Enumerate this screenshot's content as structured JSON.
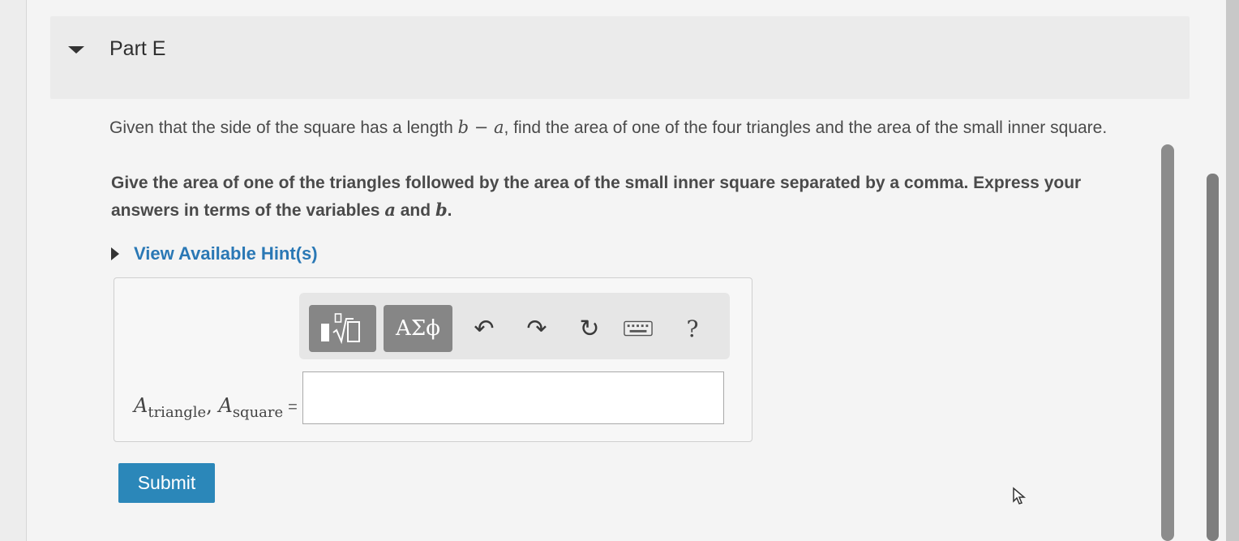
{
  "part": {
    "title": "Part E"
  },
  "question": {
    "text_pre": "Given that the side of the square has a length ",
    "expr": "b − a",
    "text_post": ", find the area of one of the four triangles and the area of the small inner square."
  },
  "instruction": {
    "text_pre": "Give the area of one of the triangles followed by the area of the small inner square separated by a comma. Express your answers in terms of the variables ",
    "var_a": "a",
    "text_mid": " and ",
    "var_b": "b",
    "text_post": "."
  },
  "hint": {
    "label": "View Available Hint(s)"
  },
  "toolbar": {
    "greek_label": "ΑΣϕ",
    "undo_glyph": "↶",
    "redo_glyph": "↷",
    "reset_glyph": "↻",
    "help_label": "?",
    "icons": [
      "templates-icon",
      "undo-icon",
      "redo-icon",
      "reset-icon",
      "keyboard-icon"
    ]
  },
  "answer": {
    "var": "A",
    "sub1": "triangle",
    "sep": ", ",
    "sub2": "square",
    "eq": "=",
    "value": ""
  },
  "submit": {
    "label": "Submit"
  },
  "colors": {
    "link": "#2a78b5",
    "submit": "#2b87b9",
    "toolbar_button": "#868686"
  }
}
